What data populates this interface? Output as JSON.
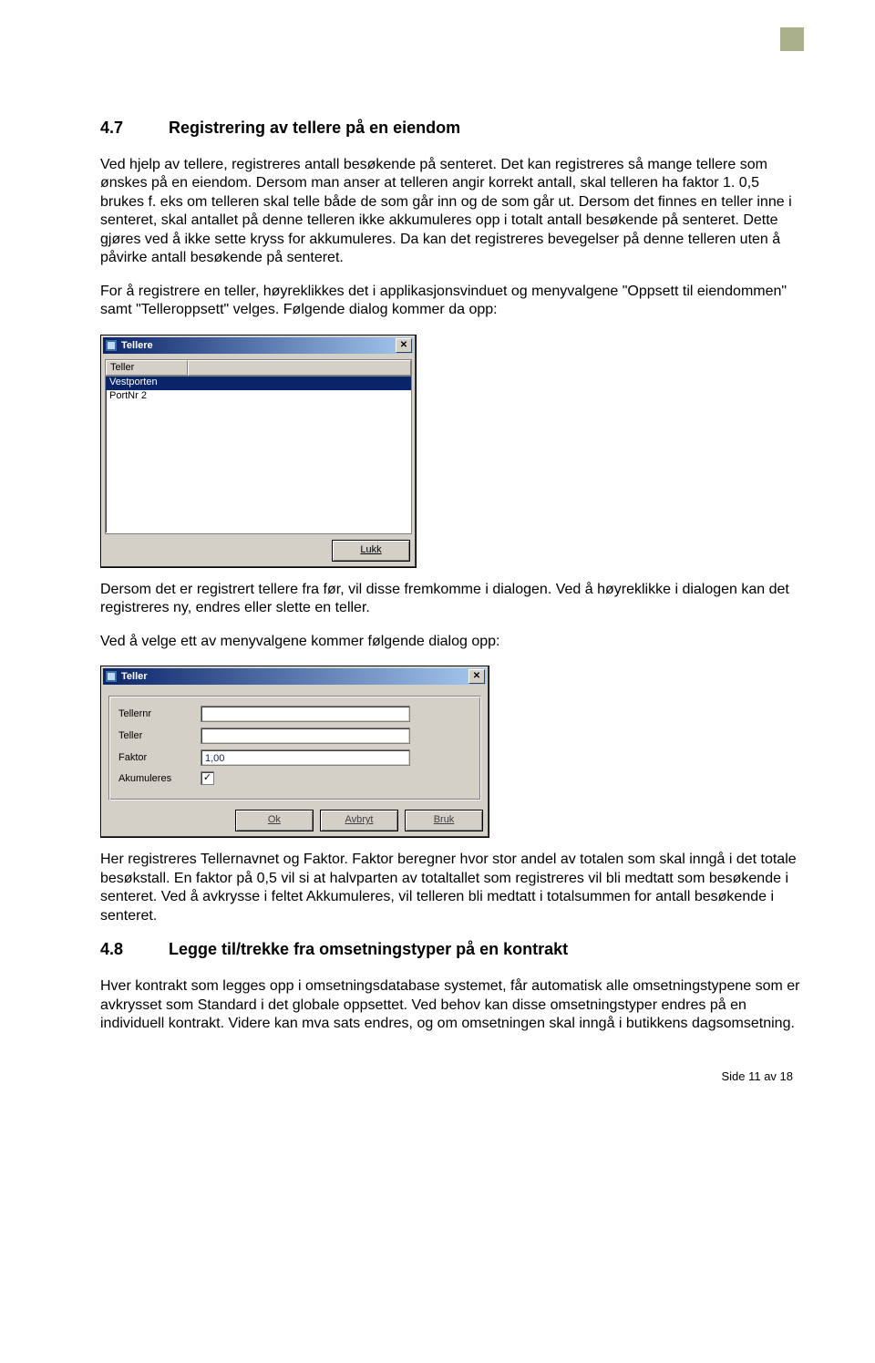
{
  "corner_color": "#aab08a",
  "section1": {
    "num": "4.7",
    "title": "Registrering av tellere på en eiendom"
  },
  "para1": "Ved hjelp av tellere, registreres antall besøkende på senteret. Det kan registreres så mange tellere som ønskes på en eiendom. Dersom man anser at telleren angir korrekt antall, skal telleren ha faktor 1. 0,5 brukes f. eks om telleren skal telle både de som går inn og de som går ut. Dersom det finnes en teller inne i senteret, skal antallet på denne telleren ikke akkumuleres opp i totalt antall besøkende på senteret. Dette gjøres ved å ikke sette kryss for akkumuleres. Da kan det registreres bevegelser på denne telleren uten å påvirke antall besøkende på senteret.",
  "para2": "For å registrere en teller, høyreklikkes det i applikasjonsvinduet og menyvalgene \"Oppsett til eiendommen\" samt \"Telleroppsett\" velges.  Følgende dialog kommer da opp:",
  "dialog1": {
    "title": "Tellere",
    "header": "Teller",
    "rows": [
      "Vestporten",
      "PortNr 2"
    ],
    "close_button": "Lukk"
  },
  "para3": "Dersom det er registrert tellere fra før, vil disse fremkomme i dialogen.  Ved å høyreklikke i dialogen kan det registreres ny, endres eller slette en teller.",
  "para4": "Ved å velge ett av menyvalgene kommer følgende dialog opp:",
  "dialog2": {
    "title": "Teller",
    "fields": {
      "tellernr_label": "Tellernr",
      "tellernr_value": "",
      "teller_label": "Teller",
      "teller_value": "",
      "faktor_label": "Faktor",
      "faktor_value": "1,00",
      "akum_label": "Akumuleres",
      "akum_checked": "✓"
    },
    "buttons": {
      "ok": "Ok",
      "avbryt": "Avbryt",
      "bruk": "Bruk"
    }
  },
  "para5": "Her registreres Tellernavnet og Faktor. Faktor beregner hvor stor andel av totalen som skal inngå i det totale besøkstall. En faktor på 0,5 vil si at halvparten av totaltallet som registreres vil bli medtatt som besøkende i senteret. Ved å avkrysse i feltet Akkumuleres, vil telleren bli medtatt i totalsummen for antall besøkende i senteret.",
  "section2": {
    "num": "4.8",
    "title": "Legge til/trekke fra omsetningstyper på en kontrakt"
  },
  "para6": "Hver kontrakt som legges opp i omsetningsdatabase systemet, får automatisk alle omsetningstypene som er avkrysset som Standard i det globale oppsettet. Ved behov kan disse omsetningstyper endres på en individuell kontrakt. Videre kan mva sats endres, og om omsetningen skal inngå i butikkens dagsomsetning.",
  "footer": "Side 11 av 18"
}
